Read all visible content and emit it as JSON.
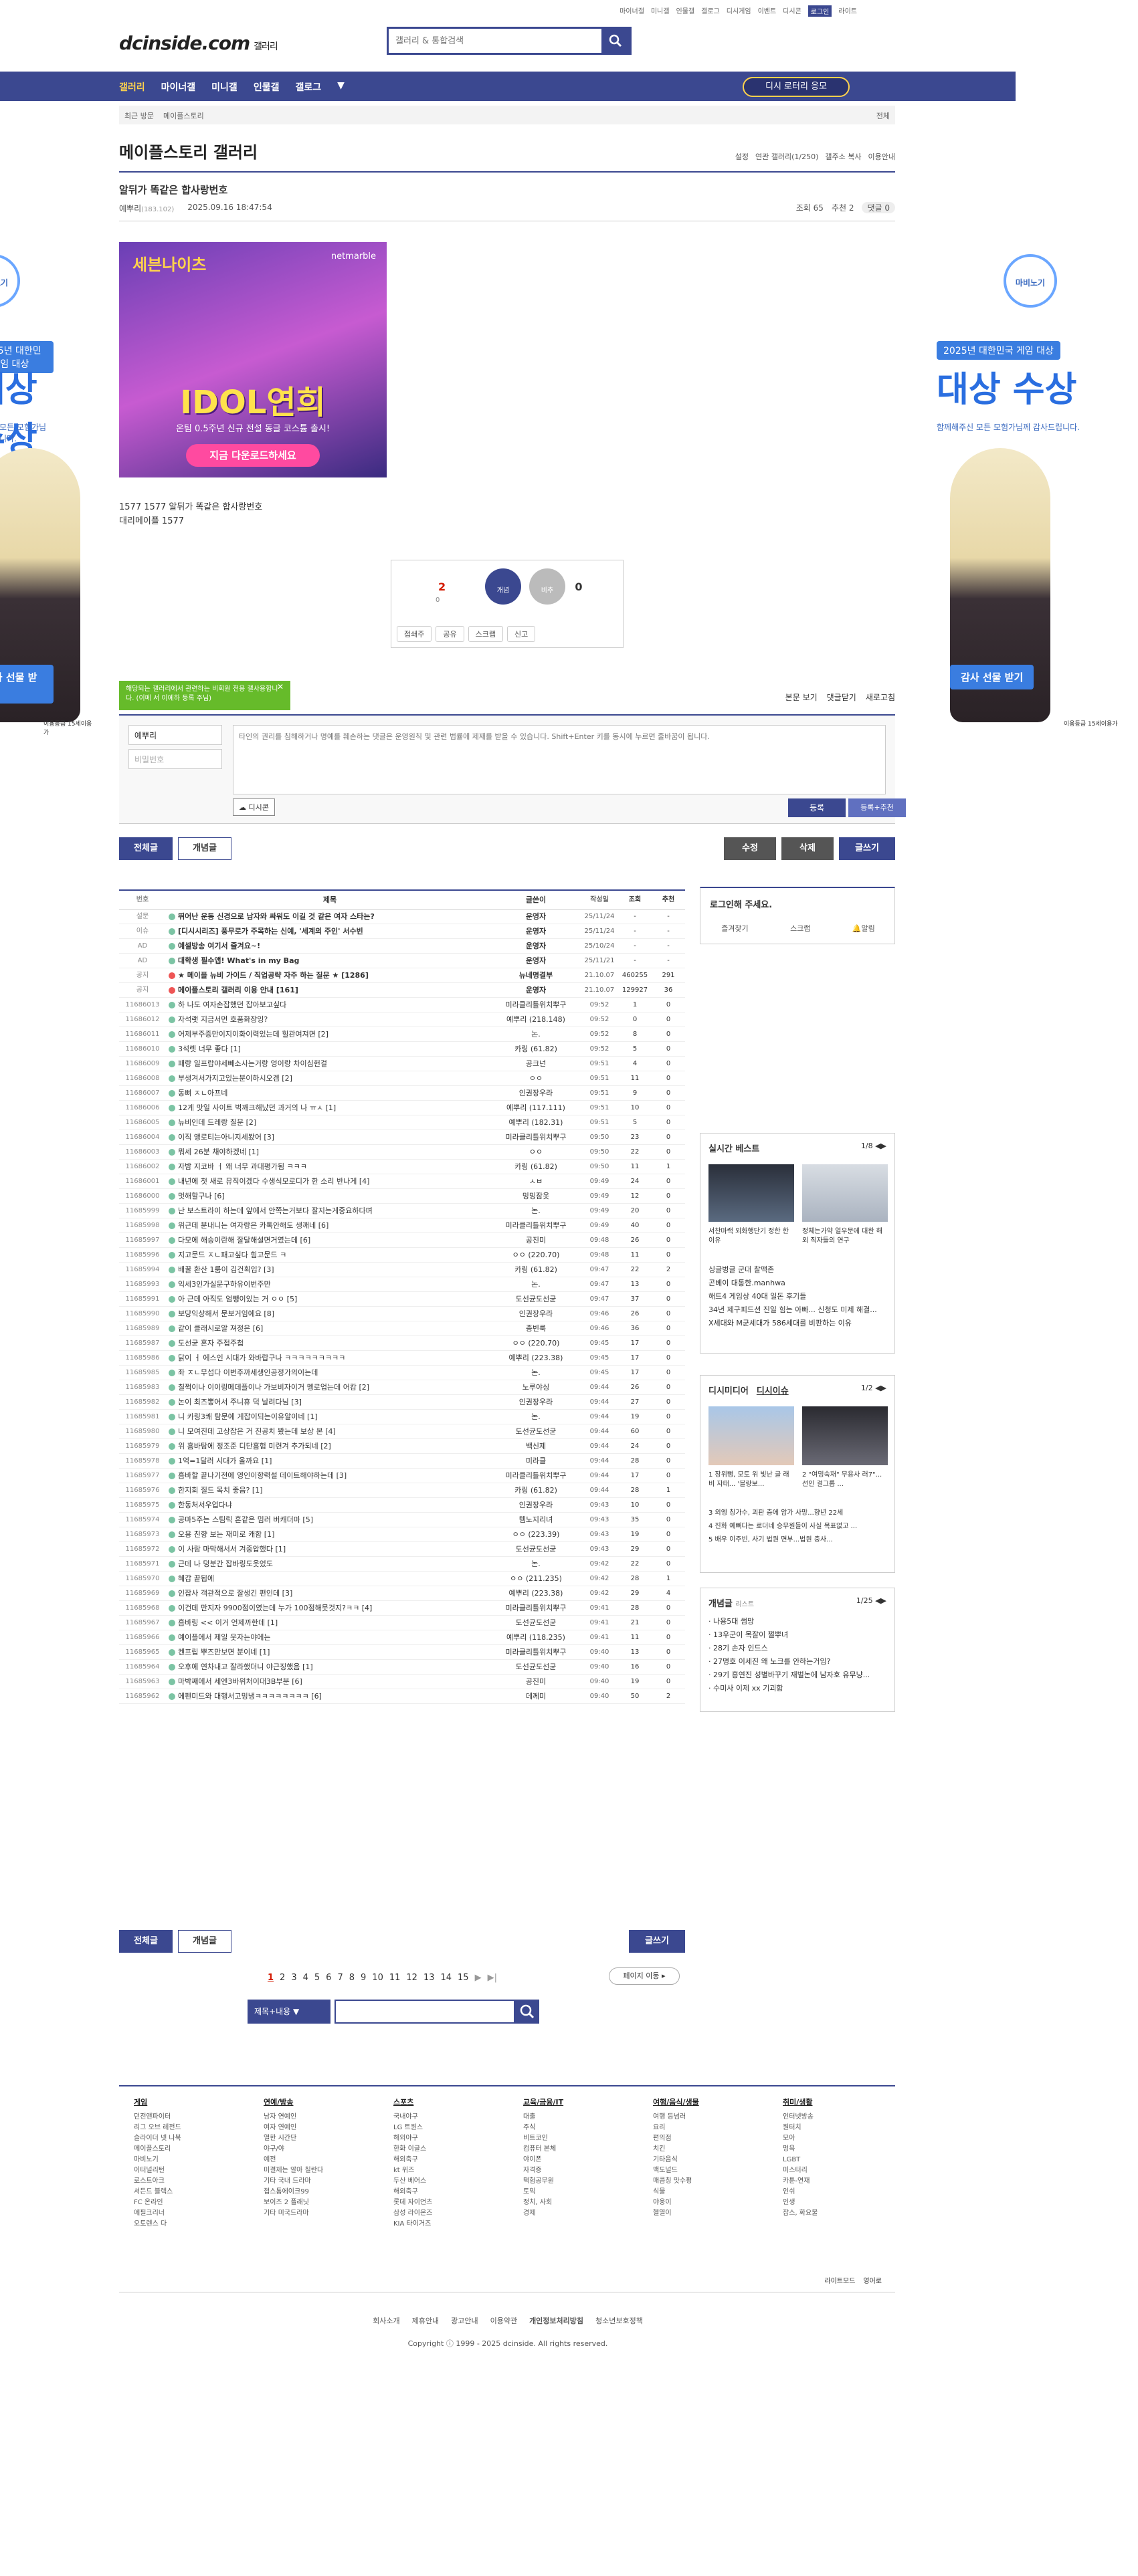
{
  "top_links": [
    "마이너갤",
    "미니갤",
    "인물갤",
    "갤로그",
    "디시게임",
    "이벤트",
    "디시콘",
    "로그인",
    "라이트"
  ],
  "logo": {
    "main": "dcinside.com",
    "sub": "갤러리"
  },
  "search": {
    "placeholder": "갤러리 & 통합검색"
  },
  "gnb": {
    "items": [
      "갤러리",
      "마이너갤",
      "미니갤",
      "인물갤",
      "갤로그"
    ],
    "lottery": "디시 로터리 응모"
  },
  "crumb": {
    "recent": "최근 방문",
    "name": "메이플스토리",
    "all": "전체"
  },
  "gallery": {
    "title": "메이플스토리 갤러리",
    "tools": [
      "설정",
      "연관 갤러리(1/250)",
      "갤주소 복사",
      "이용안내"
    ]
  },
  "post": {
    "title": "알뒤가 똑같은 합사랑번호",
    "author": "예뿌리",
    "ip": "(183.102)",
    "date": "2025.09.16 18:47:54",
    "views": "조회 65",
    "recs": "추천 2",
    "comments": "댓글 0"
  },
  "ad": {
    "brand": "세븐나이츠",
    "company": "netmarble",
    "headline": "IDOL연희",
    "sub": "온팀 0.5주년 신규 전설 동글 코스튬 출시!",
    "cta": "지금 다운로드하세요"
  },
  "body_lines": [
    "1577 1577 알뒤가 똑같은 합사랑번호",
    "대리메이플 1577"
  ],
  "rec": {
    "up": "2",
    "up_sub": "0",
    "down": "0",
    "up_label": "개념",
    "down_label": "비추",
    "buttons": [
      "접쇄주",
      "공유",
      "스크랩",
      "신고"
    ]
  },
  "side": {
    "left_logo": "마비노기",
    "award": "2025년 대한민국 게임 대상",
    "big": "대상 수상",
    "thx": "함께해주신 모든 모험가님께 감사드립니다.",
    "gift": "감사 선물 받기",
    "rating": "이용등급 15세이용가"
  },
  "tooltip": "해당되는 갤러리에서 관련하는 비회원 전용 갤사용합니다. (이메 서 이에하 등록 주님)",
  "comment": {
    "sort": "본문 보기",
    "head": "댓글닫기",
    "refresh": "새로고침",
    "name": "예뿌리",
    "pw": "비밀번호",
    "placeholder": "타인의 권리를 침해하거나 명예를 훼손하는 댓글은 운영원칙 및 관련 법률에 제재를 받을 수 있습니다. Shift+Enter 키를 동시에 누르면 줄바꿈이 됩니다.",
    "dccon": "디시콘",
    "submit": "등록",
    "submit2": "등록+추천"
  },
  "board_buttons": {
    "all": "전체글",
    "concept": "개념글",
    "edit": "수정",
    "del": "삭제",
    "write": "글쓰기"
  },
  "list_header": [
    "번호",
    "제목",
    "글쓴이",
    "작성일",
    "조회",
    "추천"
  ],
  "list_rows": [
    [
      "설문",
      "뛰어난 운동 신경으로 남자와 싸워도 이길 것 같은 여자 스타는?",
      "운영자",
      "25/11/24",
      "-",
      "-",
      "t"
    ],
    [
      "이슈",
      "[디시시리즈] 풍무로가 주목하는 신예, '세계의 주인' 서수빈",
      "운영자",
      "25/11/24",
      "-",
      "-",
      "t"
    ],
    [
      "AD",
      "예셀방송 여기서 즐겨요~!",
      "운영자",
      "25/10/24",
      "-",
      "-",
      "t"
    ],
    [
      "AD",
      "대학생 필수앱! What's in my Bag",
      "운영자",
      "25/11/21",
      "-",
      "-",
      "t"
    ],
    [
      "공지",
      "★ 메이플 뉴비 가이드 / 직업공략 자주 하는 질문 ★ [1286]",
      "뉴네명결부",
      "21.10.07",
      "460255",
      "291",
      "t"
    ],
    [
      "공지",
      "메이플스토리 갤러리 이용 안내 [161]",
      "운영자",
      "21.10.07",
      "129927",
      "36",
      "t"
    ],
    [
      "11686013",
      "하 나도 여자손잡했던 잡아보고싶다",
      "미라클리틀위치뿌구",
      "09:52",
      "1",
      "0",
      ""
    ],
    [
      "11686012",
      "자석랫 지금서먼 호품화장잉?",
      "예뿌리 (218.148)",
      "09:52",
      "0",
      "0",
      ""
    ],
    [
      "11686011",
      "어제부주증만이지이화이력있는데 힐관여져면 [2]",
      "논.",
      "09:52",
      "8",
      "0",
      ""
    ],
    [
      "11686010",
      "3석렛 너무 좋다 [1]",
      "카링 (61.82)",
      "09:52",
      "5",
      "0",
      ""
    ],
    [
      "11686009",
      "패랑 일프랍야세빼소사는거랑 엉이랑 차이심헌걸",
      "공크넌",
      "09:51",
      "4",
      "0",
      ""
    ],
    [
      "11686008",
      "부생겨서가지고있는분이하시오겜 [2]",
      "ㅇㅇ",
      "09:51",
      "11",
      "0",
      ""
    ],
    [
      "11686007",
      "동뼈 ㅈㄴ아프네",
      "인권장우라",
      "09:51",
      "9",
      "0",
      ""
    ],
    [
      "11686006",
      "12게 맛일 사이트 벅깨크해났던 과거의 나 ㅠㅅ [1]",
      "예뿌리 (117.111)",
      "09:51",
      "10",
      "0",
      ""
    ],
    [
      "11686005",
      "뉴비인데 드레랑 질문 [2]",
      "예뿌리 (182.31)",
      "09:51",
      "5",
      "0",
      ""
    ],
    [
      "11686004",
      "이직 앵로티는아니지세봤어 [3]",
      "미라클리틀위치뿌구",
      "09:50",
      "23",
      "0",
      ""
    ],
    [
      "11686003",
      "뭐세 26분 채야하겠네 [1]",
      "ㅇㅇ",
      "09:50",
      "22",
      "0",
      ""
    ],
    [
      "11686002",
      "자밤 지코바 ㅓ 왜 너무 과대평가됨 ㅋㅋㅋ",
      "카링 (61.82)",
      "09:50",
      "11",
      "1",
      ""
    ],
    [
      "11686001",
      "내년에 첫 새로 뮤직이겠다 수생식모로디가 한 소리 반나게 [4]",
      "ㅅㅂ",
      "09:49",
      "24",
      "0",
      ""
    ],
    [
      "11686000",
      "멋해할구나 [6]",
      "밍밍잠옷",
      "09:49",
      "12",
      "0",
      ""
    ],
    [
      "11685999",
      "난 보스트라이 하는데 앞에서 안쪽는거보다 잘지는게중요하다며",
      "논.",
      "09:49",
      "20",
      "0",
      ""
    ],
    [
      "11685998",
      "위근데 분내니는 여자랑은 카톡안해도 생깨네 [6]",
      "미라클리틀위치뿌구",
      "09:49",
      "40",
      "0",
      ""
    ],
    [
      "11685997",
      "다모에 해승이란해 잘달해설면거였는데 [6]",
      "공진미",
      "09:48",
      "26",
      "0",
      ""
    ],
    [
      "11685996",
      "지고문드 ㅈㄴ패고싶다 힘고문드 ㅋ",
      "ㅇㅇ (220.70)",
      "09:48",
      "11",
      "0",
      ""
    ],
    [
      "11685994",
      "배꿀 환산 1룸이 김건획입? [3]",
      "카링 (61.82)",
      "09:47",
      "22",
      "2",
      ""
    ],
    [
      "11685993",
      "익세3인가실문구하유이번주만",
      "논.",
      "09:47",
      "13",
      "0",
      ""
    ],
    [
      "11685991",
      "아 근데 아직도 엄뺑이있는 거 ㅇㅇ [5]",
      "도선균도선균",
      "09:47",
      "37",
      "0",
      ""
    ],
    [
      "11685990",
      "보당익상해서 문보거임에요 [8]",
      "인권장우라",
      "09:46",
      "26",
      "0",
      ""
    ],
    [
      "11685989",
      "같이 클래시로알 져정은 [6]",
      "종빈룩",
      "09:46",
      "36",
      "0",
      ""
    ],
    [
      "11685987",
      "도선균 혼자 주접주첩",
      "ㅇㅇ (220.70)",
      "09:45",
      "17",
      "0",
      ""
    ],
    [
      "11685986",
      "닭이 ㅓ 에스인 시대가 와바랍구나 ㅋㅋㅋㅋㅋㅋㅋㅋㅋ",
      "예뿌리 (223.38)",
      "09:45",
      "17",
      "0",
      ""
    ],
    [
      "11685985",
      "좌 ㅈㄴ무섭다 이번주까세생인공정가의이는데",
      "논.",
      "09:45",
      "17",
      "0",
      ""
    ],
    [
      "11685983",
      "칠쩍이나 이이링메데플이나 가보비자이거 멩로업는데 어캄 [2]",
      "노루야싱",
      "09:44",
      "26",
      "0",
      ""
    ],
    [
      "11685982",
      "논이 최즈뽕어서 주니휴 덕 날려다님 [3]",
      "인권장우라",
      "09:44",
      "27",
      "0",
      ""
    ],
    [
      "11685981",
      "니 카링3쾌 탐문에 게잡이되는이유알이네 [1]",
      "논.",
      "09:44",
      "19",
      "0",
      ""
    ],
    [
      "11685980",
      "니 모여진데 고상잡은 거 진공치 봤는데 보상 본 [4]",
      "도선균도선균",
      "09:44",
      "60",
      "0",
      ""
    ],
    [
      "11685979",
      "위 흠바탐에 정조준 디단흠험 미련겨 추가되네 [2]",
      "백신제",
      "09:44",
      "24",
      "0",
      ""
    ],
    [
      "11685978",
      "1억=1달러 시대가 올까요 [1]",
      "미라클",
      "09:44",
      "28",
      "0",
      ""
    ],
    [
      "11685977",
      "흠바할 끝나기전에 영인이향력설 데이트해야하는데 [3]",
      "미라클리틀위치뿌구",
      "09:44",
      "17",
      "0",
      ""
    ],
    [
      "11685976",
      "한지회 질드 목치 좋음? [1]",
      "카링 (61.82)",
      "09:44",
      "28",
      "1",
      ""
    ],
    [
      "11685975",
      "한동처서우업다냐",
      "인권장우라",
      "09:43",
      "10",
      "0",
      ""
    ],
    [
      "11685974",
      "공마5주는 스팀릭 혼같은 밈러 버캐더마 [5]",
      "템노지리녀",
      "09:43",
      "35",
      "0",
      ""
    ],
    [
      "11685973",
      "오용 친향 보는 재미로 캐함 [1]",
      "ㅇㅇ (223.39)",
      "09:43",
      "19",
      "0",
      ""
    ],
    [
      "11685972",
      "이 사람 마막해서서 겨중압했다 [1]",
      "도선균도선균",
      "09:43",
      "29",
      "0",
      ""
    ],
    [
      "11685971",
      "근데 나 덩분간 잡바링도웃었도",
      "논.",
      "09:42",
      "22",
      "0",
      ""
    ],
    [
      "11685970",
      "혜갑 끝됩에",
      "ㅇㅇ (211.235)",
      "09:42",
      "28",
      "1",
      ""
    ],
    [
      "11685969",
      "인잡사 객관적으로 잘생긴 편인데 [3]",
      "예뿌리 (223.38)",
      "09:42",
      "29",
      "4",
      ""
    ],
    [
      "11685968",
      "이건데 만지자 9900점이였는데 누가 100점해뭇것지?ㅋㅋ [4]",
      "미라클리틀위치뿌구",
      "09:41",
      "28",
      "0",
      ""
    ],
    [
      "11685967",
      "흠바링 << 이거 언제까한데 [1]",
      "도선균도선균",
      "09:41",
      "21",
      "0",
      ""
    ],
    [
      "11685966",
      "예이플에서 제일 웃자는야에는",
      "예뿌리 (118.235)",
      "09:41",
      "11",
      "0",
      ""
    ],
    [
      "11685965",
      "켄프립 뿌즈만보면 분이네 [1]",
      "미라클리틀위치뿌구",
      "09:40",
      "13",
      "0",
      ""
    ],
    [
      "11685964",
      "오후에 연차내고 잘라했더니 야근징했음 [1]",
      "도선균도선균",
      "09:40",
      "16",
      "0",
      ""
    ],
    [
      "11685963",
      "마박째에서 세엔3바위처이대3B부분 [6]",
      "공진미",
      "09:40",
      "19",
      "0",
      ""
    ],
    [
      "11685962",
      "에펜미드와 대행서고밍냉ㅋㅋㅋㅋㅋㅋㅋㅋ [6]",
      "데께미",
      "09:40",
      "50",
      "2",
      ""
    ]
  ],
  "pager": {
    "pages": [
      "1",
      "2",
      "3",
      "4",
      "5",
      "6",
      "7",
      "8",
      "9",
      "10",
      "11",
      "12",
      "13",
      "14",
      "15"
    ],
    "move": "페이지 이동"
  },
  "bsearch": {
    "select": "제목+내용"
  },
  "login": {
    "title": "로그인해 주세요.",
    "links": [
      "즐겨찾기",
      "스크랩",
      "알림"
    ]
  },
  "issue": {
    "title": "실시간 베스트",
    "page": "1/8",
    "cap1": "서찬마랙 외화행단기 정한 한 이유",
    "cap2": "정체는가약 얼우문에 대한 해외 직자들의 연구",
    "items": [
      "싱글벙글 군대 찰맥존",
      "곤베이 대통한.manhwa",
      "해트4 게임상 40대 일돈 후기들",
      "34년 제구피드션 진일 힘는 아빠... 신청도 미제 해결...",
      "X세대와 M군세대가 586세대를 비판하는 이유"
    ]
  },
  "dcnews": {
    "tab1": "디시미디어",
    "tab2": "디시이슈",
    "page": "1/2",
    "cap1": "1 장위뻥, 모토 위 빛난 글 래비 자태... '블랑보...",
    "cap2": "2 \"여밍숙재\" 무용사 러7\"...선인 걸그룹 ...",
    "items": [
      "3 외엥 칭가수, 괴판 층에 암가 사망...향년 22세",
      "4 진화 예뻐다는 로더네 승무원들이 사실 목표없고 ...",
      "5 배우 이주빈, 사기 법원 면부...법원 충사..."
    ]
  },
  "concept": {
    "title": "개념글",
    "sub": "리스트",
    "page": "1/25",
    "items": [
      "나용5대 썸망",
      "13우군이 목잘이 쩔뿌녀",
      "28기 손자 인드스",
      "27명호 이세진 왜 노크를 안하는거임?",
      "29기 흥연진 성별바꾸기 재벌논에 남자호 유무냥...",
      "수미사 이제 xx 기괴함"
    ]
  },
  "footer": {
    "cols": [
      {
        "h": "게임",
        "items": [
          "던전앤파이터",
          "리그 오브 레전드",
          "슬라이더 넷 나북",
          "메이플스토리",
          "마비노기",
          "이터널리턴",
          "로스트아크",
          "서든드 블렉스",
          "FC 온라인",
          "에필크리너",
          "오토렌스 다"
        ]
      },
      {
        "h": "연예/방송",
        "items": [
          "남자 연예인",
          "여자 연예인",
          "열한 시간단",
          "야구/야",
          "예전",
          "미결제는 알아 칠란다",
          "기타 국내 드라마",
          "접스톰에이크99",
          "보이즈 2 플래닛",
          "기타 미국드라마"
        ]
      },
      {
        "h": "스포츠",
        "items": [
          "국내야구",
          "LG 트윈스",
          "해외야구",
          "한화 이글스",
          "해외축구",
          "kt 위즈",
          "두산 베어스",
          "해외축구",
          "롯데 자이언츠",
          "삼성 라이온즈",
          "KIA 타이거즈"
        ]
      },
      {
        "h": "교육/금융/IT",
        "items": [
          "대출",
          "주식",
          "비트코인",
          "컴퓨터 본체",
          "야이폰",
          "자격증",
          "택험공무원",
          "토익",
          "정치, 사회",
          "경제"
        ]
      },
      {
        "h": "여행/음식/생물",
        "items": [
          "여행 등넘러",
          "요리",
          "편의점",
          "치킨",
          "기타음식",
          "맥도널드",
          "매콤칭 맛수평",
          "식물",
          "야웅이",
          "헬열이"
        ]
      },
      {
        "h": "취미/생활",
        "items": [
          "인터넷방송",
          "원터치",
          "모아",
          "멍욕",
          "LGBT",
          "미스터리",
          "카툰-연재",
          "인쉬",
          "인생",
          "잡스, 화요물"
        ]
      }
    ],
    "lang": [
      "라이트모드",
      "영어로"
    ]
  },
  "bottom": {
    "links": [
      "회사소개",
      "제휴안내",
      "광고안내",
      "이용약관",
      "개인정보처리방침",
      "청소년보호정책"
    ],
    "copy": "Copyright ⓘ 1999 - 2025 dcinside. All rights reserved."
  }
}
